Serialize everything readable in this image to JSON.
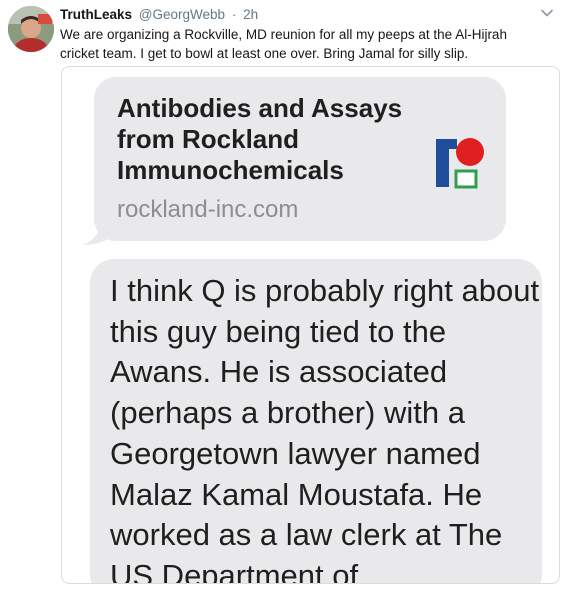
{
  "tweet": {
    "display_name": "TruthLeaks",
    "handle": "@GeorgWebb",
    "separator": "·",
    "time": "2h",
    "text": "We are organizing a Rockville, MD reunion for all my peeps at the Al-Hijrah cricket team. I get to bowl at least one over.  Bring Jamal for silly slip."
  },
  "media": {
    "link_preview": {
      "title": "Antibodies and Assays from Rockland Immunochemicals",
      "domain": "rockland-inc.com",
      "logo_icon": "rockland-logo-icon"
    },
    "message": "I think Q is probably right about this guy being tied to the Awans. He is associated (perhaps a brother) with a Georgetown lawyer named Malaz Kamal Moustafa. He worked as a law clerk at The US Department of"
  },
  "colors": {
    "bubble": "#e9e9eb",
    "muted_text": "#657786",
    "logo_blue": "#1f4e9a",
    "logo_red": "#e02020",
    "logo_green": "#2e9e4f"
  }
}
